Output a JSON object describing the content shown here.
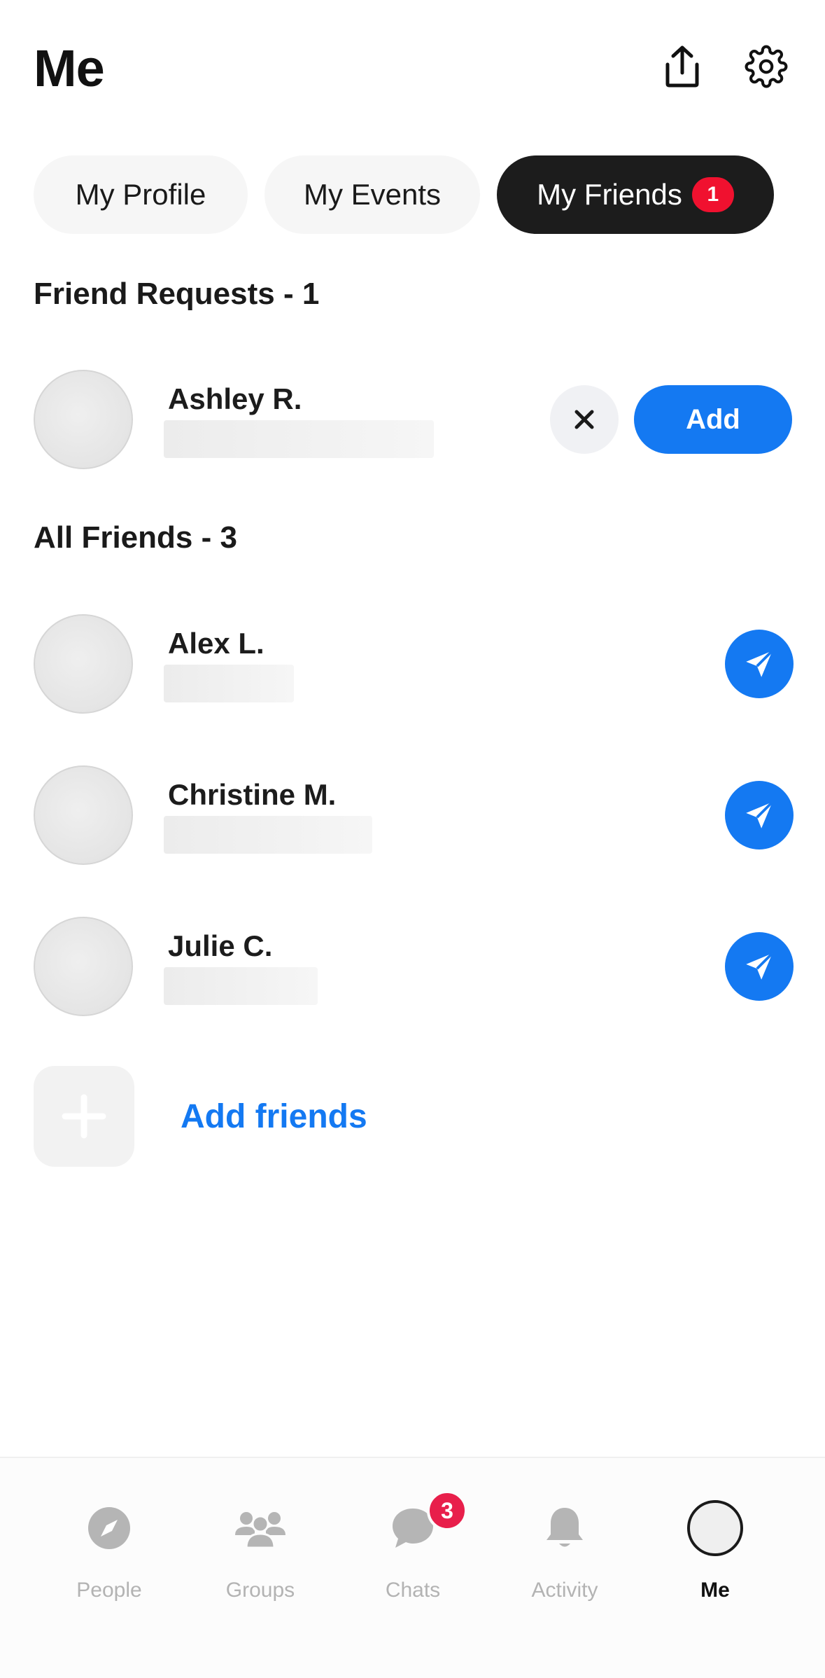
{
  "header": {
    "title": "Me",
    "share_icon": "share-icon",
    "settings_icon": "gear-icon"
  },
  "tabs": [
    {
      "label": "My Profile",
      "active": false
    },
    {
      "label": "My Events",
      "active": false
    },
    {
      "label": "My Friends",
      "active": true,
      "badge": "1"
    }
  ],
  "friend_requests": {
    "title": "Friend Requests - 1",
    "items": [
      {
        "name": "Ashley R.",
        "add_label": "Add"
      }
    ]
  },
  "all_friends": {
    "title": "All Friends - 3",
    "items": [
      {
        "name": "Alex L."
      },
      {
        "name": "Christine M."
      },
      {
        "name": "Julie C."
      }
    ]
  },
  "add_friends": {
    "label": "Add friends"
  },
  "bottom_nav": [
    {
      "label": "People",
      "icon": "compass-icon",
      "active": false
    },
    {
      "label": "Groups",
      "icon": "group-icon",
      "active": false
    },
    {
      "label": "Chats",
      "icon": "chat-bubble-icon",
      "active": false,
      "badge": "3"
    },
    {
      "label": "Activity",
      "icon": "bell-icon",
      "active": false
    },
    {
      "label": "Me",
      "icon": "avatar",
      "active": true
    }
  ],
  "colors": {
    "accent": "#1479f2",
    "badge_red": "#f0112f",
    "active_tab": "#1c1c1c"
  }
}
